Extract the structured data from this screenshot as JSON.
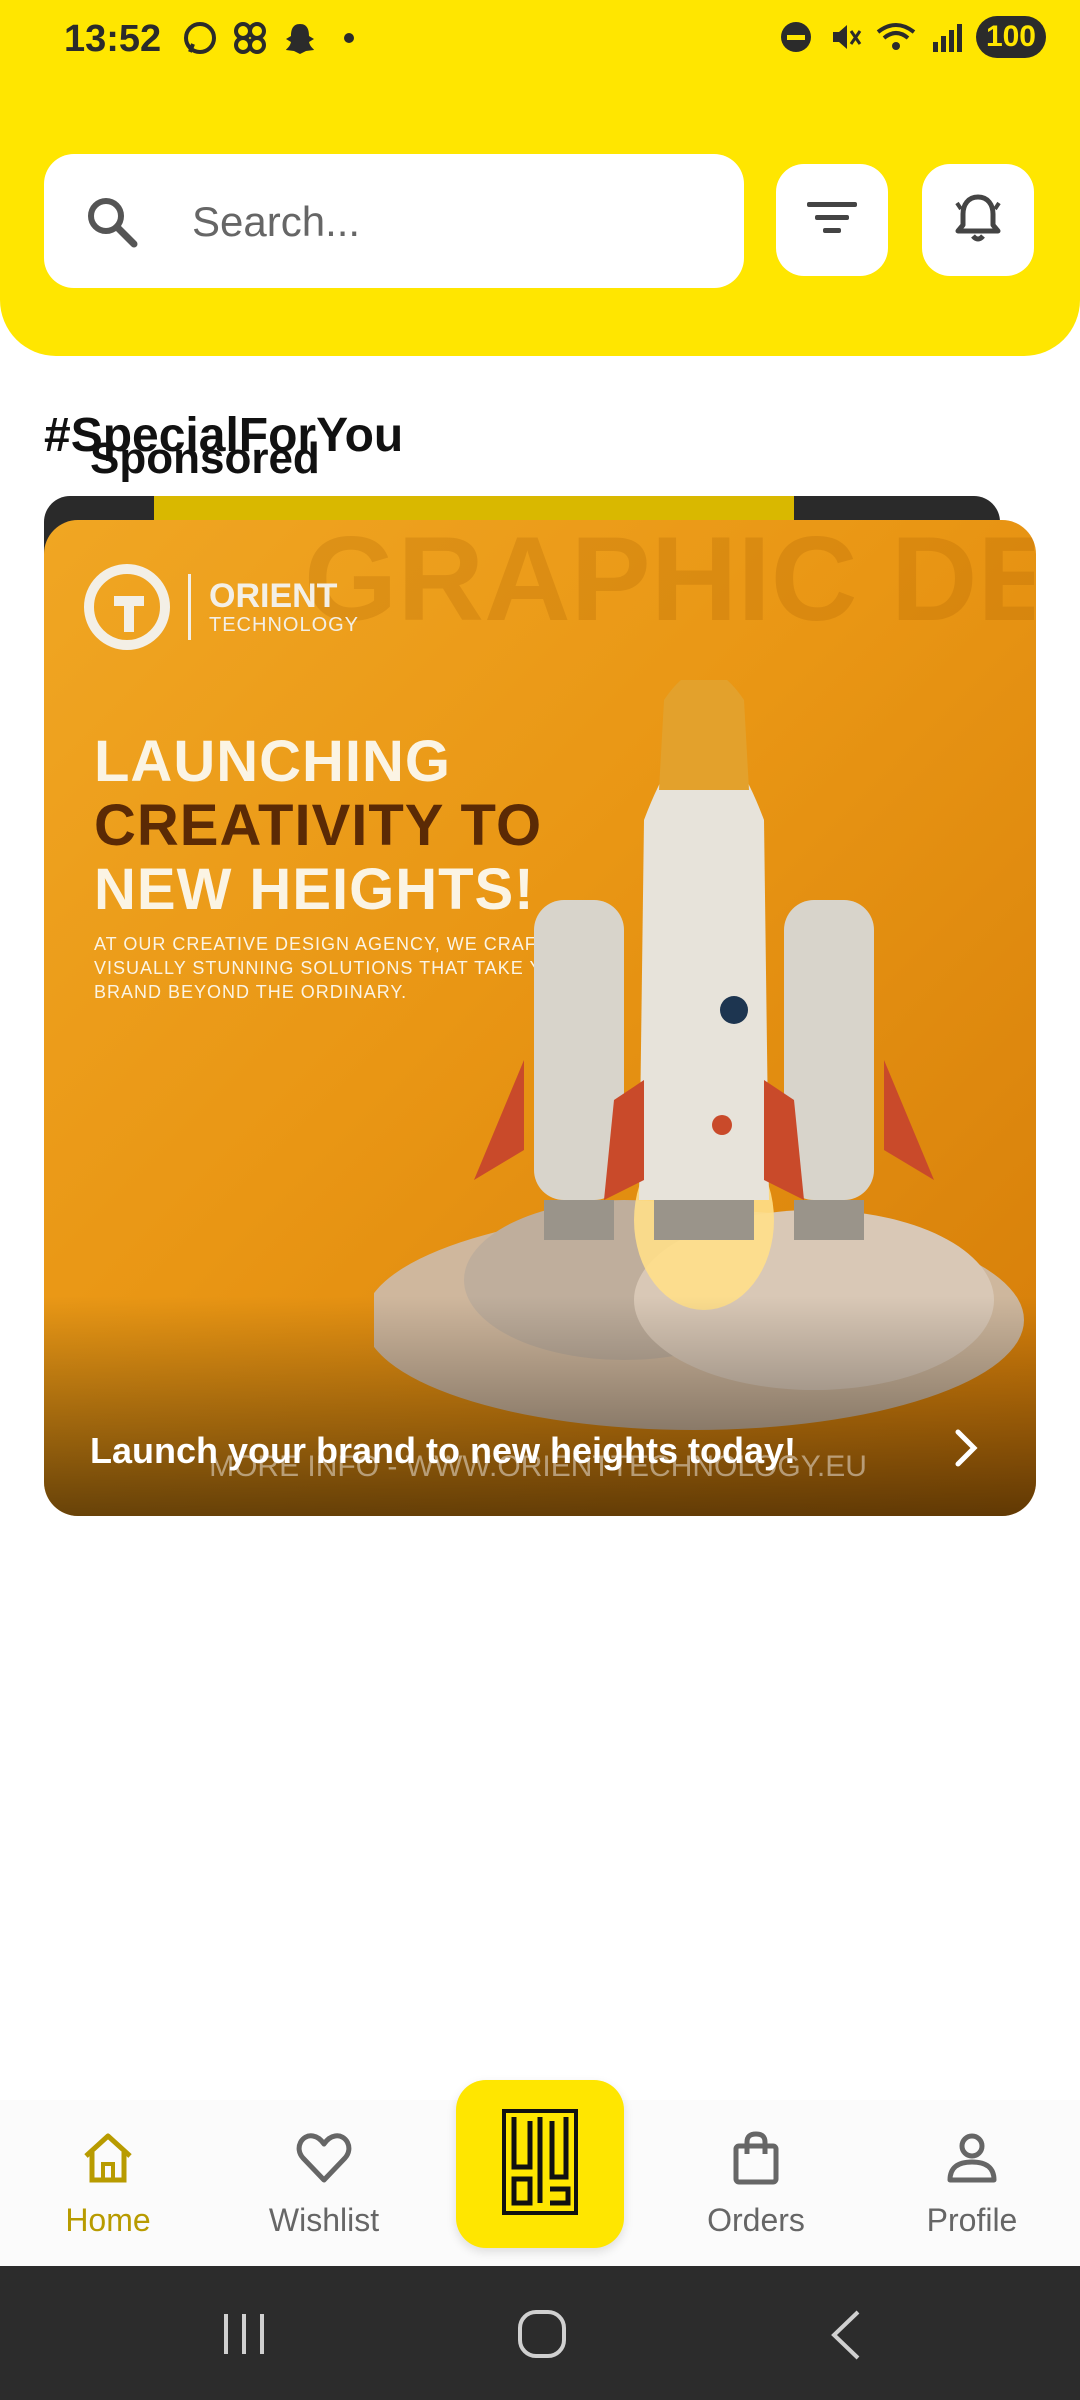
{
  "status_bar": {
    "time": "13:52",
    "battery": "100",
    "icons_left": [
      "whatsapp-icon",
      "link-icon",
      "snapchat-icon",
      "dot-icon"
    ],
    "icons_right": [
      "dnd-icon",
      "mute-icon",
      "wifi-icon",
      "signal-icon",
      "battery-icon"
    ]
  },
  "search": {
    "placeholder": "Search..."
  },
  "header_buttons": [
    "filter-icon",
    "bell-icon"
  ],
  "section": {
    "title": "#SpecialForYou",
    "sponsored_label": "Sponsored"
  },
  "card": {
    "brand": "ORIENT",
    "brand_sub": "TECHNOLOGY",
    "watermark": "GRAPHIC DESIGN",
    "headline_line1": "LAUNCHING",
    "headline_line2": "CREATIVITY TO",
    "headline_line3": "NEW HEIGHTS!",
    "subtext": "AT OUR CREATIVE DESIGN AGENCY, WE CRAFT VISUALLY STUNNING SOLUTIONS THAT TAKE YOUR BRAND BEYOND THE ORDINARY.",
    "caption": "Launch your brand to new heights today!",
    "footer": "MORE INFO - WWW.ORIENTTECHNOLOGY.EU",
    "colors": {
      "bg": "#E99614",
      "dark_text": "#5B2A05"
    }
  },
  "bottom_nav": {
    "items": [
      {
        "label": "Home",
        "icon": "home-icon",
        "active": true
      },
      {
        "label": "Wishlist",
        "icon": "heart-icon",
        "active": false
      },
      {
        "label": "Orders",
        "icon": "bag-icon",
        "active": false
      },
      {
        "label": "Profile",
        "icon": "user-icon",
        "active": false
      }
    ],
    "center_icon": "calligraphy-logo-icon"
  },
  "colors": {
    "accent": "#FFE600",
    "active_nav": "#B89B00"
  }
}
